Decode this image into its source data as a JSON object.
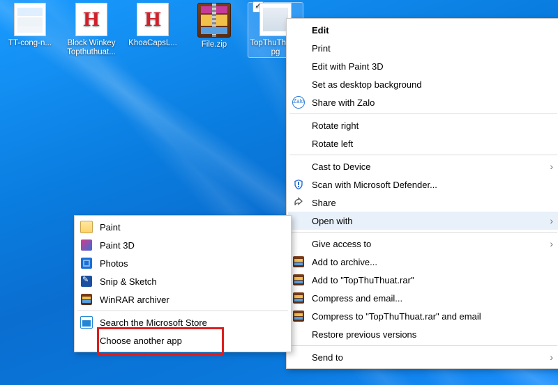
{
  "desktop": {
    "items": [
      {
        "caption": "TT-cong-n...",
        "thumb": "screenshot",
        "selected": false
      },
      {
        "caption": "Block Winkey Topthuthuat...",
        "thumb": "h",
        "selected": false
      },
      {
        "caption": "KhoaCapsL...",
        "thumb": "h",
        "selected": false
      },
      {
        "caption": "File.zip",
        "thumb": "zip",
        "selected": false
      },
      {
        "caption": "TopThuThuat.jpg",
        "thumb": "img",
        "selected": true
      }
    ]
  },
  "context_menu": {
    "items": [
      {
        "label": "Edit",
        "bold": true
      },
      {
        "label": "Print"
      },
      {
        "label": "Edit with Paint 3D"
      },
      {
        "label": "Set as desktop background"
      },
      {
        "label": "Share with Zalo",
        "icon": "zalo"
      },
      {
        "sep": true
      },
      {
        "label": "Rotate right"
      },
      {
        "label": "Rotate left"
      },
      {
        "sep": true
      },
      {
        "label": "Cast to Device",
        "submenu": true
      },
      {
        "label": "Scan with Microsoft Defender...",
        "icon": "shield"
      },
      {
        "label": "Share",
        "icon": "shareA"
      },
      {
        "label": "Open with",
        "submenu": true,
        "current": true
      },
      {
        "sep": true
      },
      {
        "label": "Give access to",
        "submenu": true
      },
      {
        "label": "Add to archive...",
        "icon": "rar"
      },
      {
        "label": "Add to \"TopThuThuat.rar\"",
        "icon": "rar"
      },
      {
        "label": "Compress and email...",
        "icon": "rar"
      },
      {
        "label": "Compress to \"TopThuThuat.rar\" and email",
        "icon": "rar"
      },
      {
        "label": "Restore previous versions"
      },
      {
        "sep": true
      },
      {
        "label": "Send to",
        "submenu": true
      }
    ]
  },
  "openwith_menu": {
    "items": [
      {
        "label": "Paint",
        "icon": "paint"
      },
      {
        "label": "Paint 3D",
        "icon": "paint3d"
      },
      {
        "label": "Photos",
        "icon": "photos"
      },
      {
        "label": "Snip & Sketch",
        "icon": "snip"
      },
      {
        "label": "WinRAR archiver",
        "icon": "rar"
      },
      {
        "sep": true
      },
      {
        "label": "Search the Microsoft Store",
        "icon": "store"
      },
      {
        "label": "Choose another app",
        "highlight": true
      }
    ]
  }
}
